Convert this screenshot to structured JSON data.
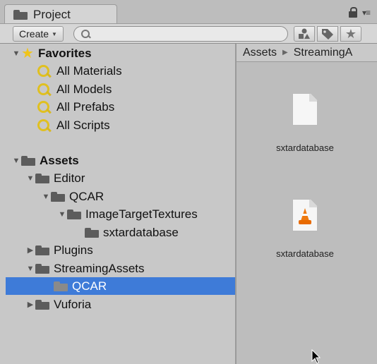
{
  "window": {
    "tab_title": "Project",
    "menu_glyph": "▾≡"
  },
  "toolbar": {
    "create_label": "Create",
    "search_value": "",
    "search_placeholder": ""
  },
  "tree": {
    "favorites": {
      "label": "Favorites",
      "items": [
        "All Materials",
        "All Models",
        "All Prefabs",
        "All Scripts"
      ]
    },
    "assets": {
      "label": "Assets",
      "items": [
        {
          "label": "Editor",
          "expanded": true
        },
        {
          "label": "QCAR",
          "expanded": true
        },
        {
          "label": "ImageTargetTextures",
          "expanded": true
        },
        {
          "label": "sxtardatabase",
          "expanded": false
        },
        {
          "label": "Plugins",
          "expanded": false
        },
        {
          "label": "StreamingAssets",
          "expanded": true
        },
        {
          "label": "QCAR",
          "selected": true
        },
        {
          "label": "Vuforia",
          "expanded": false
        }
      ]
    },
    "selection_color": "#3e7bd8"
  },
  "breadcrumb": [
    "Assets",
    "StreamingA"
  ],
  "assets_view": [
    {
      "name": "sxtardatabase",
      "icon": "file-icon"
    },
    {
      "name": "sxtardatabase",
      "icon": "vlc-cone-icon"
    }
  ]
}
